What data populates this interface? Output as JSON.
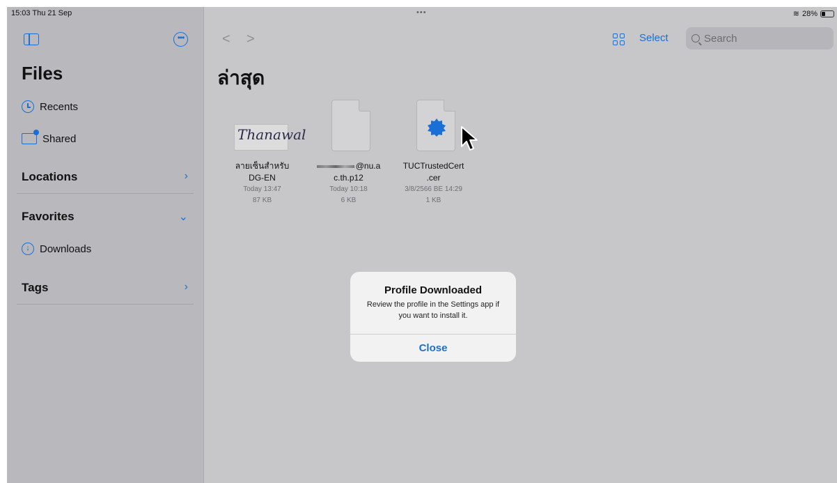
{
  "status": {
    "time": "15:03  Thu 21 Sep",
    "battery": "28%"
  },
  "sidebar": {
    "title": "Files",
    "items": [
      {
        "label": "Recents",
        "icon": "clock-icon"
      },
      {
        "label": "Shared",
        "icon": "shared-folder-icon"
      }
    ],
    "sections": [
      {
        "label": "Locations",
        "chevron": "›"
      },
      {
        "label": "Favorites",
        "chevron": "⌄"
      },
      {
        "label": "Tags",
        "chevron": "›"
      }
    ],
    "favorites": [
      {
        "label": "Downloads",
        "icon": "download-icon"
      }
    ]
  },
  "toolbar": {
    "select_label": "Select",
    "search_placeholder": "Search"
  },
  "main": {
    "title": "ล่าสุด",
    "files": [
      {
        "name_line1": "ลายเซ็นสำหรับ",
        "name_line2": "DG-EN",
        "date": "Today 13:47",
        "size": "87 KB",
        "thumb_text": "Thanawal"
      },
      {
        "name_line1": "@nu.a",
        "name_line2": "c.th.p12",
        "date": "Today 10:18",
        "size": "6 KB"
      },
      {
        "name_line1": "TUCTrustedCert",
        "name_line2": ".cer",
        "date": "3/8/2566 BE 14:29",
        "size": "1 KB"
      }
    ]
  },
  "dialog": {
    "title": "Profile Downloaded",
    "message": "Review the profile in the Settings app if you want to install it.",
    "button": "Close"
  }
}
